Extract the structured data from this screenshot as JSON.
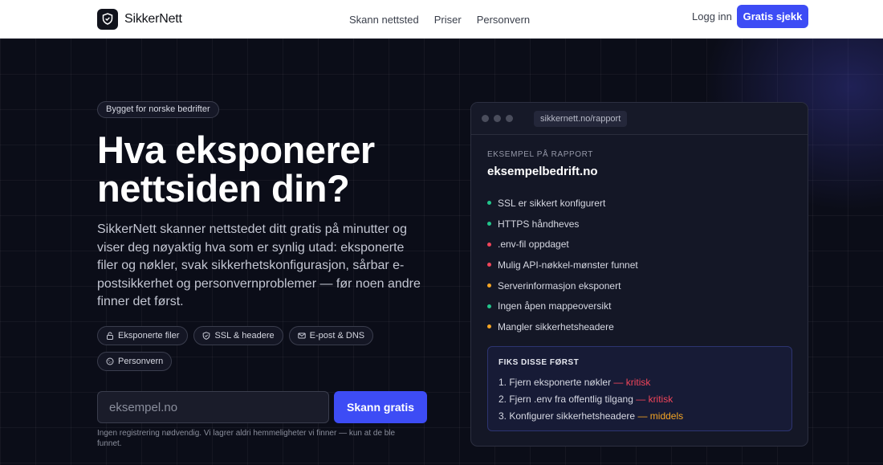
{
  "header": {
    "brand": "SikkerNett",
    "nav": [
      "Skann nettsted",
      "Priser",
      "Personvern"
    ],
    "login": "Logg inn",
    "cta": "Gratis sjekk"
  },
  "hero": {
    "badge": "Bygget for norske bedrifter",
    "title": "Hva eksponerer nettsiden din?",
    "description": "SikkerNett skanner nettstedet ditt gratis på minutter og viser deg nøyaktig hva som er synlig utad: eksponerte filer og nøkler, svak sikkerhetskonfigurasjon, sårbar e-postsikkerhet og personvernproblemer — før noen andre finner det først.",
    "chips": [
      {
        "label": "Eksponerte filer",
        "icon": "lock-icon"
      },
      {
        "label": "SSL & headere",
        "icon": "shield-icon"
      },
      {
        "label": "E-post & DNS",
        "icon": "mail-icon"
      },
      {
        "label": "Personvern",
        "icon": "cookie-icon"
      }
    ],
    "search": {
      "placeholder": "eksempel.no",
      "button": "Skann gratis"
    },
    "note": "Ingen registrering nødvendig. Vi lagrer aldri hemmeligheter vi finner — kun at de ble funnet."
  },
  "report": {
    "url": "sikkernett.no/rapport",
    "kicker": "EKSEMPEL PÅ RAPPORT",
    "domain": "eksempelbedrift.no",
    "findings": [
      {
        "text": "SSL er sikkert konfigurert",
        "status": "ok"
      },
      {
        "text": "HTTPS håndheves",
        "status": "ok"
      },
      {
        "text": ".env-fil oppdaget",
        "status": "critical"
      },
      {
        "text": "Mulig API-nøkkel-mønster funnet",
        "status": "critical"
      },
      {
        "text": "Serverinformasjon eksponert",
        "status": "medium"
      },
      {
        "text": "Ingen åpen mappeoversikt",
        "status": "ok"
      },
      {
        "text": "Mangler sikkerhetsheadere",
        "status": "medium"
      }
    ],
    "fix_title": "FIKS DISSE FØRST",
    "fixes": [
      {
        "text": "1. Fjern eksponerte nøkler",
        "separator": " — ",
        "severity": "kritisk",
        "level": "critical"
      },
      {
        "text": "2. Fjern .env fra offentlig tilgang",
        "separator": " — ",
        "severity": "kritisk",
        "level": "critical"
      },
      {
        "text": "3. Konfigurer sikkerhetsheadere",
        "separator": " — ",
        "severity": "middels",
        "level": "medium"
      }
    ]
  },
  "colors": {
    "accent": "#3d4cf5",
    "ok": "#22c58b",
    "critical": "#f0455a",
    "medium": "#f5a524",
    "background": "#0b0d18"
  }
}
